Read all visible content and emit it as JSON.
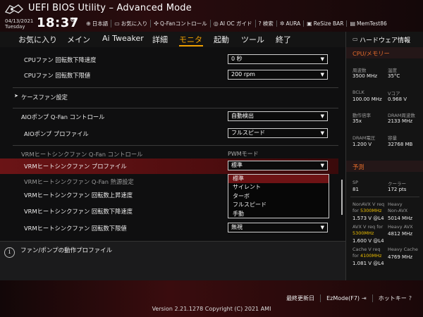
{
  "header": {
    "title": "UEFI BIOS Utility – Advanced Mode",
    "date": "04/13/2021",
    "day": "Tuesday",
    "time": "18:37",
    "quick": [
      {
        "icon": "globe-icon",
        "glyph": "⊕",
        "label": "日本語"
      },
      {
        "icon": "favorites-icon",
        "glyph": "▭",
        "label": "お気に入り"
      },
      {
        "icon": "fan-icon",
        "glyph": "✣",
        "label": "Q-Fanコントロール"
      },
      {
        "icon": "ai-oc-icon",
        "glyph": "◎",
        "label": "AI OC ガイド"
      },
      {
        "icon": "search-icon",
        "glyph": "?",
        "label": "検索"
      },
      {
        "icon": "aura-icon",
        "glyph": "✲",
        "label": "AURA"
      },
      {
        "icon": "resize-bar-icon",
        "glyph": "▣",
        "label": "ReSize BAR"
      },
      {
        "icon": "memtest-icon",
        "glyph": "▤",
        "label": "MemTest86"
      }
    ]
  },
  "menu": {
    "items": [
      "お気に入り",
      "メイン",
      "Ai Tweaker",
      "詳細",
      "モニタ",
      "起動",
      "ツール",
      "終了"
    ],
    "active": "モニタ"
  },
  "settings": [
    {
      "label": "CPUファン 回転数下降速度",
      "value": "0 秒"
    },
    {
      "label": "CPUファン 回転数下限値",
      "value": "200 rpm"
    },
    {
      "label": "ケースファン設定"
    },
    {
      "label": "AIOポンプ Q-Fan コントロール",
      "value": "自動検出"
    },
    {
      "label": "AIOポンプ プロファイル",
      "value": "フルスピード"
    },
    {
      "label": "VRMヒートシンクファン Q-Fan コントロール",
      "value": "PWMモード"
    },
    {
      "label": "VRMヒートシンクファン プロファイル",
      "value": "標準"
    },
    {
      "label": "VRMヒートシンクファン Q-Fan 熱源設定"
    },
    {
      "label": "VRMヒートシンクファン 回転数上昇速度"
    },
    {
      "label": "VRMヒートシンクファン 回転数下降速度"
    },
    {
      "label": "VRMヒートシンクファン 回転数下限値",
      "value": "無視"
    }
  ],
  "dropdown": {
    "options": [
      "標準",
      "サイレント",
      "ターボ",
      "フルスピード",
      "手動"
    ],
    "selected": "標準"
  },
  "help": {
    "text": "ファン/ポンプの動作プロファイル"
  },
  "hw_monitor": {
    "title": "ハードウェア情報",
    "cpu_section": "CPU/メモリー",
    "cpu": {
      "freq_label": "周波数",
      "freq": "3500 MHz",
      "temp_label": "温度",
      "temp": "35°C",
      "bclk_label": "BCLK",
      "bclk": "100.00 MHz",
      "vcore_label": "Vコア",
      "vcore": "0.968 V",
      "ratio_label": "動作倍率",
      "ratio": "35x",
      "dram_freq_label": "DRAM周波数",
      "dram_freq": "2133 MHz",
      "dram_volt_label": "DRAM電圧",
      "dram_volt": "1.200 V",
      "capacity_label": "容量",
      "capacity": "32768 MB"
    },
    "predict_section": "予測",
    "predict": {
      "sp_label": "SP",
      "sp": "81",
      "cooler_label": "クーラー",
      "cooler": "172 pts",
      "nonavx_req_label": "NonAVX V req",
      "nonavx_req_for": "for ",
      "nonavx_freq": "5300MHz",
      "nonavx_val": "1.573 V @L4",
      "heavy_nonavx_label1": "Heavy",
      "heavy_nonavx_label2": "Non-AVX",
      "heavy_nonavx": "5014 MHz",
      "avx_req_label": "AVX V req for",
      "avx_freq": "5300MHz",
      "avx_val": "1.600 V @L4",
      "heavy_avx_label": "Heavy AVX",
      "heavy_avx": "4812 MHz",
      "cache_req_label": "Cache V req",
      "cache_req_for": "for ",
      "cache_freq": "4100MHz",
      "cache_val": "1.081 V @L4",
      "heavy_cache_label": "Heavy Cache",
      "heavy_cache": "4769 MHz"
    }
  },
  "footer": {
    "buttons": [
      {
        "label": "最終更新日",
        "icon": "",
        "name": "last-modified-button"
      },
      {
        "label": "EzMode(F7)",
        "icon": "⇥",
        "name": "ezmode-button"
      },
      {
        "label": "ホットキー",
        "icon": "?",
        "name": "hotkeys-button"
      }
    ],
    "version": "Version 2.21.1278 Copyright (C) 2021 AMI"
  },
  "colors": {
    "accent": "#f0a000",
    "highlight": "#6b1416",
    "brand_red": "#8a1a1c",
    "predict_highlight": "#f0c000"
  }
}
